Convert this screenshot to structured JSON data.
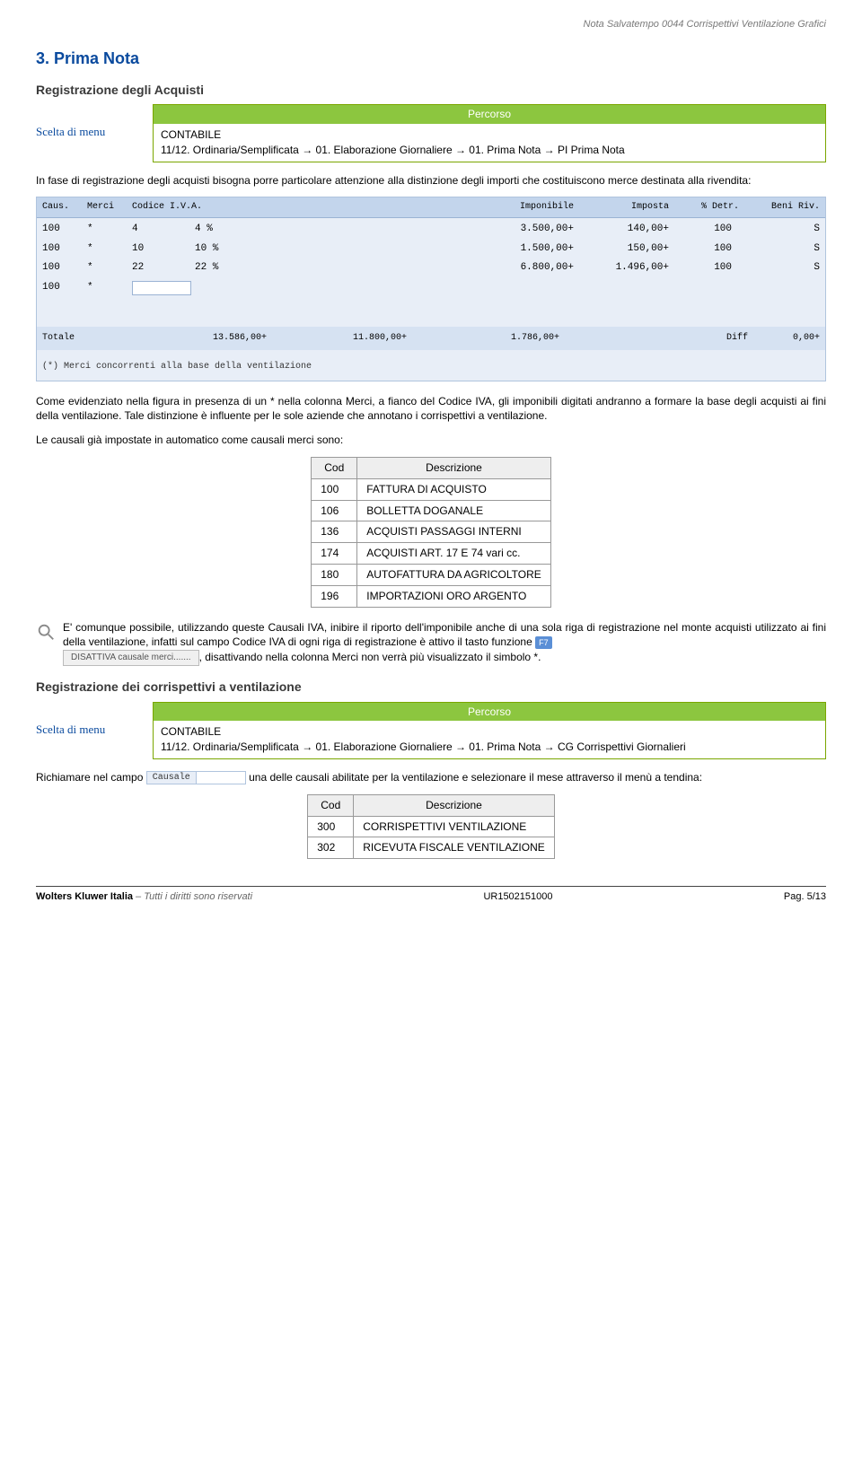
{
  "header_note": "Nota Salvatempo  0044 Corrispettivi Ventilazione Grafici",
  "section_title": "3. Prima Nota",
  "sub1_title": "Registrazione degli Acquisti",
  "scelta_label": "Scelta di menu",
  "percorso_label": "Percorso",
  "percorso1_line1": "CONTABILE",
  "percorso1_line2": "11/12. Ordinaria/Semplificata → 01. Elaborazione Giornaliere → 01. Prima Nota → PI Prima Nota",
  "intro1": "In fase di registrazione degli acquisti bisogna porre particolare attenzione alla distinzione degli importi che costituiscono merce destinata alla rivendita:",
  "screenshot": {
    "headers": [
      "Caus.",
      "Merci",
      "Codice I.V.A.",
      "",
      "Imponibile",
      "Imposta",
      "% Detr.",
      "Beni Riv."
    ],
    "rows": [
      {
        "caus": "100",
        "merci": "*",
        "cod": "4",
        "perc": "4 %",
        "imp": "3.500,00+",
        "imposta": "140,00+",
        "detr": "100",
        "beni": "S"
      },
      {
        "caus": "100",
        "merci": "*",
        "cod": "10",
        "perc": "10 %",
        "imp": "1.500,00+",
        "imposta": "150,00+",
        "detr": "100",
        "beni": "S"
      },
      {
        "caus": "100",
        "merci": "*",
        "cod": "22",
        "perc": "22 %",
        "imp": "6.800,00+",
        "imposta": "1.496,00+",
        "detr": "100",
        "beni": "S"
      },
      {
        "caus": "100",
        "merci": "*",
        "cod": "",
        "perc": "",
        "imp": "",
        "imposta": "",
        "detr": "",
        "beni": ""
      }
    ],
    "total": {
      "label": "Totale",
      "c1": "13.586,00+",
      "c2": "11.800,00+",
      "c3": "1.786,00+",
      "diff_lbl": "Diff",
      "diff": "0,00+"
    },
    "note": "(*) Merci concorrenti alla base della ventilazione"
  },
  "para2": "Come evidenziato nella figura in presenza di un * nella colonna Merci, a fianco del Codice IVA, gli imponibili digitati andranno a formare la base degli acquisti ai fini della ventilazione. Tale distinzione è influente per le sole aziende che annotano i corrispettivi a ventilazione.",
  "para3": "Le causali già impostate in automatico come causali merci sono:",
  "causali_headers": {
    "cod": "Cod",
    "desc": "Descrizione"
  },
  "causali": [
    {
      "cod": "100",
      "desc": "FATTURA DI ACQUISTO"
    },
    {
      "cod": "106",
      "desc": "BOLLETTA DOGANALE"
    },
    {
      "cod": "136",
      "desc": "ACQUISTI PASSAGGI INTERNI"
    },
    {
      "cod": "174",
      "desc": "ACQUISTI ART. 17 E 74 vari cc."
    },
    {
      "cod": "180",
      "desc": "AUTOFATTURA DA AGRICOLTORE"
    },
    {
      "cod": "196",
      "desc": "IMPORTAZIONI ORO ARGENTO"
    }
  ],
  "para4_a": "E' comunque possibile, utilizzando queste Causali IVA, inibire il riporto dell'imponibile anche di una sola riga di registrazione nel monte acquisti utilizzato ai fini della ventilazione, infatti sul campo Codice IVA di ogni riga di registrazione è attivo il tasto funzione ",
  "f7": "F7",
  "disattiva": "DISATTIVA causale merci.......",
  "para4_b": ", disattivando nella colonna Merci non verrà più visualizzato il simbolo *.",
  "sub2_title": "Registrazione dei corrispettivi a ventilazione",
  "percorso2_line1": "CONTABILE",
  "percorso2_line2": "11/12. Ordinaria/Semplificata → 01. Elaborazione Giornaliere → 01. Prima Nota → CG Corrispettivi Giornalieri",
  "para5_a": "Richiamare nel campo ",
  "causale_label": "Causale",
  "para5_b": " una delle causali abilitate per la ventilazione e selezionare il mese attraverso il menù a tendina:",
  "causali2": [
    {
      "cod": "300",
      "desc": "CORRISPETTIVI VENTILAZIONE"
    },
    {
      "cod": "302",
      "desc": "RICEVUTA FISCALE VENTILAZIONE"
    }
  ],
  "footer": {
    "company": "Wolters Kluwer Italia",
    "rights": " – Tutti i diritti sono riservati",
    "code": "UR1502151000",
    "page": "Pag. 5/13"
  }
}
